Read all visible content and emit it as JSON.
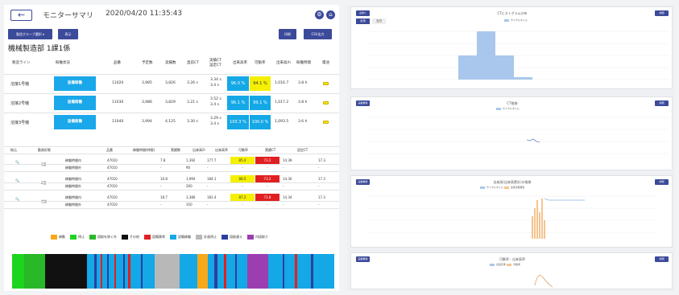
{
  "header": {
    "back_icon": "arrow-left-icon",
    "title": "モニターサマリ",
    "datetime": "2020/04/20 11:35:43",
    "icons": [
      "gear-icon",
      "home-icon"
    ]
  },
  "toolbar": {
    "group_select": "製造グループ選択 ▾",
    "display": "表示",
    "print": "印刷",
    "csv": "CSV出力"
  },
  "section_title": "機械製造部 1課1係",
  "lines_table": {
    "headers": [
      "製造ライン",
      "稼働状況",
      "品番",
      "予定数",
      "実績数",
      "直前CT",
      "実績CT\n設定CT",
      "出来高率",
      "可動率",
      "出来高/h",
      "稼働時間",
      "電池"
    ],
    "rows": [
      {
        "line": "溶接1号機",
        "status": "設備稼働",
        "part": "11020",
        "plan": "3,985",
        "actual": "3,826",
        "prev_ct": "3.26 s",
        "ct1": "3.34 s",
        "ct2": "3.4 s",
        "yield_rate": "96.0 %",
        "avail_rate": "94.1 %",
        "per_hour": "1,016.7",
        "hours": "3.8 h"
      },
      {
        "line": "溶接2号機",
        "status": "設備稼働",
        "part": "11030",
        "plan": "3,986",
        "actual": "3,829",
        "prev_ct": "3.21 s",
        "ct1": "3.52 s",
        "ct2": "3.4 s",
        "yield_rate": "96.1 %",
        "avail_rate": "99.1 %",
        "per_hour": "1,017.2",
        "hours": "3.8 h"
      },
      {
        "line": "溶接3号機",
        "status": "設備稼働",
        "part": "11040",
        "plan": "3,994",
        "actual": "4,125",
        "prev_ct": "3.30 s",
        "ct1": "3.29 s",
        "ct2": "3.4 s",
        "yield_rate": "103.3 %",
        "avail_rate": "100.0 %",
        "per_hour": "1,093.5",
        "hours": "3.6 h"
      }
    ]
  },
  "shift_table": {
    "headers": [
      "絞込",
      "勤務形態",
      "",
      "品番",
      "稼働時間(時間)",
      "実績数",
      "出来高/h",
      "出来高率",
      "可動率",
      "実績CT",
      "設定CT"
    ],
    "rows": [
      {
        "shift": "1直",
        "type": "稼働時間内",
        "part": "47010",
        "hours": "7.8",
        "actual": "1,392",
        "per_hour": "177.7",
        "yield": "85.4",
        "avail": "73.2",
        "act_ct": "14.39",
        "set_ct": "17.3"
      },
      {
        "shift": "",
        "type": "稼働時間外",
        "part": "47010",
        "hours": "-",
        "actual": "90",
        "per_hour": "-",
        "yield": "-",
        "avail": "-",
        "act_ct": "-",
        "set_ct": "-"
      },
      {
        "shift": "2直",
        "type": "稼働時間内",
        "part": "47010",
        "hours": "10.8",
        "actual": "1,994",
        "per_hour": "184.1",
        "yield": "88.5",
        "avail": "73.2",
        "act_ct": "14.30",
        "set_ct": "17.3"
      },
      {
        "shift": "",
        "type": "稼働時間外",
        "part": "47010",
        "hours": "-",
        "actual": "260",
        "per_hour": "-",
        "yield": "-",
        "avail": "-",
        "act_ct": "-",
        "set_ct": "-"
      },
      {
        "shift": "合計",
        "type": "稼働時間内",
        "part": "47010",
        "hours": "18.7",
        "actual": "3,386",
        "per_hour": "181.4",
        "yield": "87.2",
        "avail": "72.8",
        "act_ct": "14.34",
        "set_ct": "17.3"
      },
      {
        "shift": "",
        "type": "稼働時間外",
        "part": "47010",
        "hours": "-",
        "actual": "350",
        "per_hour": "-",
        "yield": "-",
        "avail": "-",
        "act_ct": "-",
        "set_ct": "-"
      }
    ]
  },
  "legend": [
    {
      "label": "稼動",
      "color": "#f7a81b"
    },
    {
      "label": "停止",
      "color": "#1ed51e"
    },
    {
      "label": "段取を除く外",
      "color": "#28b828"
    },
    {
      "label": "その他",
      "color": "#111111"
    },
    {
      "label": "設備異常",
      "color": "#e02020"
    },
    {
      "label": "設備稼働",
      "color": "#14a8e6"
    },
    {
      "label": "計画停止",
      "color": "#b8b8b8"
    },
    {
      "label": "段取違え",
      "color": "#2c3fa0"
    },
    {
      "label": "内段取り",
      "color": "#9b3fb0"
    }
  ],
  "timeline": [
    {
      "c": "#1ed51e",
      "w": 3.5
    },
    {
      "c": "#28b828",
      "w": 6
    },
    {
      "c": "#111111",
      "w": 12
    },
    {
      "c": "#14a8e6",
      "w": 2
    },
    {
      "c": "#2c3fa0",
      "w": 0.8
    },
    {
      "c": "#14a8e6",
      "w": 1
    },
    {
      "c": "#e02020",
      "w": 0.6
    },
    {
      "c": "#14a8e6",
      "w": 1.2
    },
    {
      "c": "#2c3fa0",
      "w": 0.6
    },
    {
      "c": "#14a8e6",
      "w": 1.5
    },
    {
      "c": "#e02020",
      "w": 0.5
    },
    {
      "c": "#14a8e6",
      "w": 2
    },
    {
      "c": "#2c3fa0",
      "w": 0.6
    },
    {
      "c": "#14a8e6",
      "w": 1
    },
    {
      "c": "#e02020",
      "w": 0.5
    },
    {
      "c": "#14a8e6",
      "w": 3
    },
    {
      "c": "#2c3fa0",
      "w": 0.6
    },
    {
      "c": "#14a8e6",
      "w": 3.5
    },
    {
      "c": "#b8b8b8",
      "w": 7
    },
    {
      "c": "#14a8e6",
      "w": 5
    },
    {
      "c": "#f7a81b",
      "w": 3
    },
    {
      "c": "#14a8e6",
      "w": 2
    },
    {
      "c": "#2c3fa0",
      "w": 0.8
    },
    {
      "c": "#14a8e6",
      "w": 2
    },
    {
      "c": "#e02020",
      "w": 0.6
    },
    {
      "c": "#14a8e6",
      "w": 2.5
    },
    {
      "c": "#2c3fa0",
      "w": 0.6
    },
    {
      "c": "#14a8e6",
      "w": 3
    },
    {
      "c": "#9b3fb0",
      "w": 6
    },
    {
      "c": "#14a8e6",
      "w": 4
    },
    {
      "c": "#2c3fa0",
      "w": 0.6
    },
    {
      "c": "#14a8e6",
      "w": 3
    },
    {
      "c": "#e02020",
      "w": 0.6
    },
    {
      "c": "#14a8e6",
      "w": 4
    },
    {
      "c": "#2c3fa0",
      "w": 0.6
    },
    {
      "c": "#14a8e6",
      "w": 6
    }
  ],
  "charts": [
    {
      "btn_left": "全体ヒ",
      "btn_right": "詳細",
      "title": "CTヒストグラム分布",
      "tabs": [
        "全体",
        "当日"
      ],
      "legend": [
        "サイクルタイム"
      ]
    },
    {
      "btn_left": "実績推移",
      "btn_right": "詳細",
      "title": "CT推移",
      "legend": [
        "サイクルタイム"
      ]
    },
    {
      "btn_left": "実績推移",
      "btn_right": "詳細",
      "title": "出来高(出来高累計)の推移",
      "legend": [
        "サイクルタイム",
        "出来高数累計"
      ]
    },
    {
      "btn_left": "実績推移",
      "btn_right": "詳細",
      "title": "可動率・出来高率",
      "legend": [
        "出来高率",
        "可動率"
      ]
    }
  ]
}
